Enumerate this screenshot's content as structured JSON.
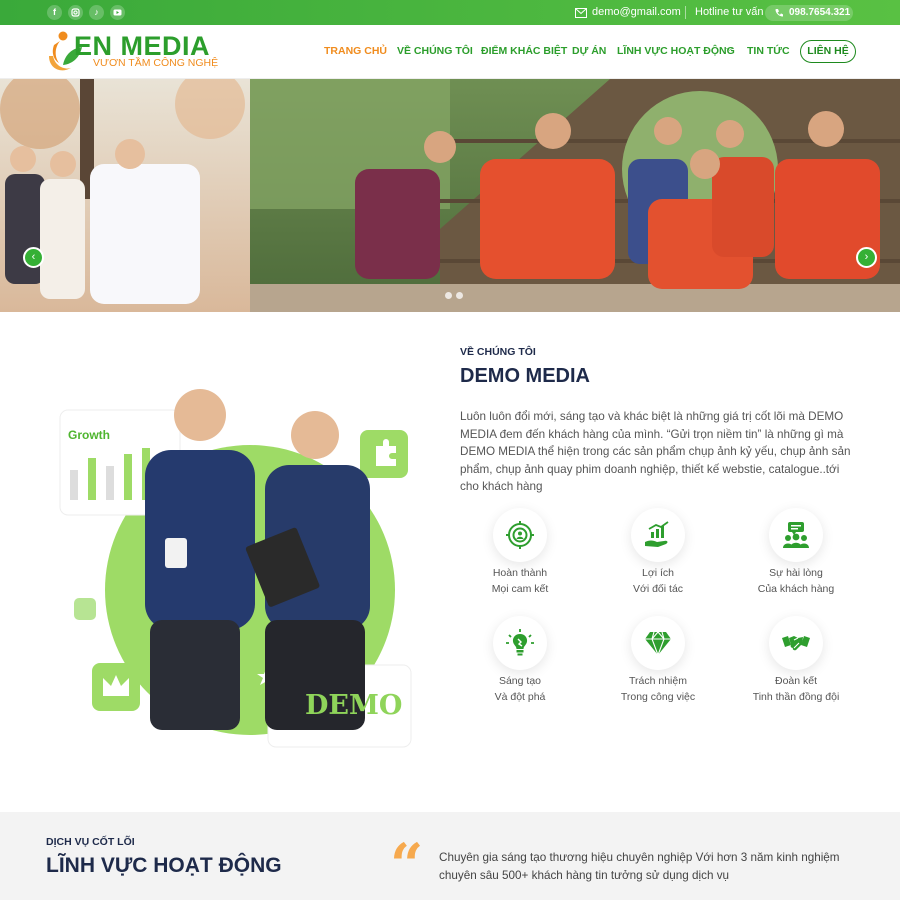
{
  "topbar": {
    "social_icons": [
      "facebook-icon",
      "instagram-icon",
      "tiktok-icon",
      "youtube-icon"
    ],
    "email": "demo@gmail.com",
    "hotline_label": "Hotline tư vấn",
    "phone": "098.7654.321"
  },
  "brand": {
    "title": "EN MEDIA",
    "tagline": "VƯƠN TẦM CÔNG NGHỆ",
    "primary_color": "#2c9e2c",
    "accent_color": "#f08c1e"
  },
  "nav": {
    "items": [
      "TRANG CHỦ",
      "VỀ CHÚNG TÔI",
      "ĐIỂM KHÁC BIỆT",
      "DỰ ÁN",
      "LĨNH VỰC HOẠT ĐỘNG",
      "TIN TỨC"
    ],
    "active": "TRANG CHỦ",
    "contact": "LIÊN HỆ"
  },
  "hero": {
    "dots": 2
  },
  "about": {
    "tag": "VỀ CHÚNG TÔI",
    "title": "DEMO MEDIA",
    "text": "Luôn luôn đổi mới, sáng tạo và khác biệt là những giá trị cốt lõi mà DEMO MEDIA đem đến khách hàng của mình. “Gửi trọn niềm tin” là những gì mà DEMO MEDIA thể hiện trong các sản phẩm chụp ảnh kỷ yếu, chụp ảnh sản phẩm, chụp ảnh quay phim doanh nghiệp, thiết kế webstie, catalogue..tới cho khách hàng",
    "image": {
      "growth_label": "Growth",
      "demo_label": "DEMO"
    },
    "features": [
      {
        "line1": "Hoàn thành",
        "line2": "Mọi cam kết",
        "icon": "target-icon"
      },
      {
        "line1": "Lợi ích",
        "line2": "Với đối tác",
        "icon": "growth-hand-icon"
      },
      {
        "line1": "Sự hài lòng",
        "line2": "Của khách hàng",
        "icon": "customers-icon"
      },
      {
        "line1": "Sáng tạo",
        "line2": "Và đột phá",
        "icon": "lightbulb-icon"
      },
      {
        "line1": "Trách nhiệm",
        "line2": "Trong công việc",
        "icon": "diamond-icon"
      },
      {
        "line1": "Đoàn kết",
        "line2": "Tinh thần đồng đội",
        "icon": "handshake-icon"
      }
    ]
  },
  "services": {
    "tag": "DỊCH VỤ CỐT LÕI",
    "title": "LĨNH VỰC HOẠT ĐỘNG",
    "quote": "Chuyên gia sáng tạo thương hiệu chuyên nghiệp Với hơn 3 năm kinh nghiệm chuyên sâu 500+ khách hàng tin tưởng sử dụng dịch vụ"
  }
}
